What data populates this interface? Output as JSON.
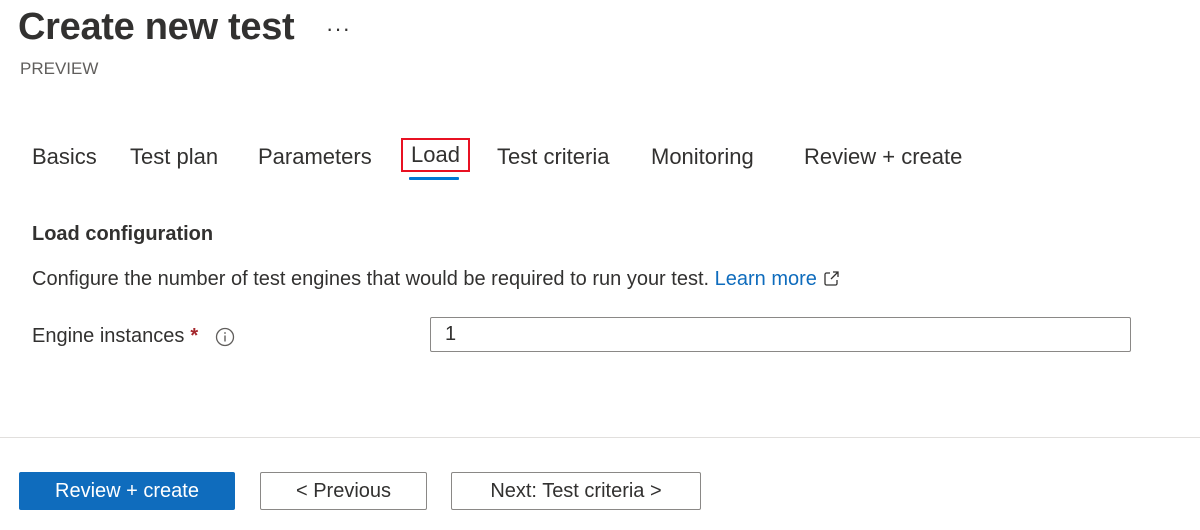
{
  "header": {
    "title": "Create new test",
    "more_label": "···",
    "subtitle": "PREVIEW"
  },
  "tabs": [
    {
      "label": "Basics",
      "active": false
    },
    {
      "label": "Test plan",
      "active": false
    },
    {
      "label": "Parameters",
      "active": false
    },
    {
      "label": "Load",
      "active": true
    },
    {
      "label": "Test criteria",
      "active": false
    },
    {
      "label": "Monitoring",
      "active": false
    },
    {
      "label": "Review + create",
      "active": false
    }
  ],
  "load": {
    "section_title": "Load configuration",
    "description": "Configure the number of test engines that would be required to run your test.",
    "learn_more": "Learn more",
    "engine_label": "Engine instances",
    "required_mark": "*",
    "engine_value": "1"
  },
  "footer": {
    "review_create": "Review + create",
    "previous": "< Previous",
    "next": "Next: Test criteria >"
  },
  "colors": {
    "accent": "#0f6cbd",
    "tab_underline": "#0078d4",
    "highlight_box": "#e81123",
    "required": "#a4262c"
  }
}
